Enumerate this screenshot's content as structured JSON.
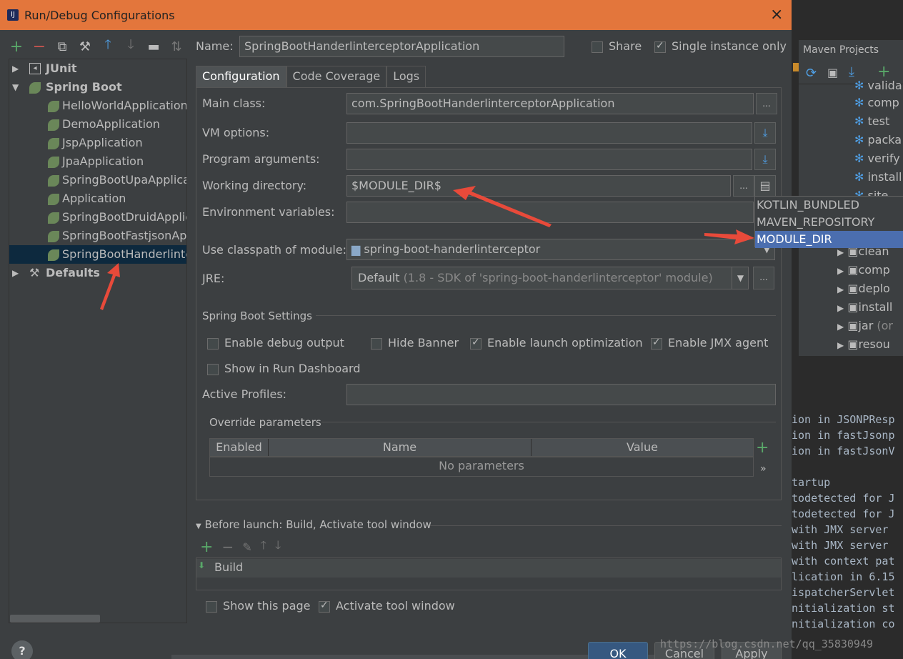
{
  "window": {
    "title": "Run/Debug Configurations",
    "close": "×"
  },
  "tree": {
    "junit": "JUnit",
    "spring_boot": "Spring Boot",
    "items": [
      "HelloWorldApplication",
      "DemoApplication",
      "JspApplication",
      "JpaApplication",
      "SpringBootUpaApplicati",
      "Application",
      "SpringBootDruidApplic",
      "SpringBootFastjsonApp",
      "SpringBootHanderlinte"
    ],
    "defaults": "Defaults"
  },
  "name": {
    "label": "Name:",
    "value": "SpringBootHanderlinterceptorApplication"
  },
  "share": "Share",
  "single_instance": "Single instance only",
  "tabs": [
    "Configuration",
    "Code Coverage",
    "Logs"
  ],
  "form": {
    "main_class_label": "Main class:",
    "main_class_value": "com.SpringBootHanderlinterceptorApplication",
    "vm_label": "VM options:",
    "program_args_label": "Program arguments:",
    "working_dir_label": "Working directory:",
    "working_dir_value": "$MODULE_DIR$",
    "env_label": "Environment variables:",
    "classpath_label": "Use classpath of module:",
    "classpath_value": "spring-boot-handerlinterceptor",
    "jre_label": "JRE:",
    "jre_value": "Default",
    "jre_hint": "(1.8 - SDK of 'spring-boot-handerlinterceptor' module)",
    "more": "..."
  },
  "spring_settings": {
    "title": "Spring Boot Settings",
    "debug_output": "Enable debug output",
    "hide_banner": "Hide Banner",
    "launch_opt": "Enable launch optimization",
    "jmx": "Enable JMX agent",
    "run_dashboard": "Show in Run Dashboard",
    "active_profiles": "Active Profiles:"
  },
  "override": {
    "title": "Override parameters",
    "columns": [
      "Enabled",
      "Name",
      "Value"
    ],
    "empty": "No parameters",
    "plus": "+",
    "more": "»"
  },
  "popup": [
    "KOTLIN_BUNDLED",
    "MAVEN_REPOSITORY",
    "MODULE_DIR"
  ],
  "before_launch": {
    "title": "Before launch: Build, Activate tool window",
    "task": "Build"
  },
  "bottom": {
    "show_page": "Show this page",
    "activate_tool": "Activate tool window"
  },
  "buttons": {
    "ok": "OK",
    "cancel": "Cancel",
    "apply": "Apply",
    "help": "?"
  },
  "maven": {
    "title": "Maven Projects",
    "items": [
      "valida",
      "comp",
      "test",
      "packa",
      "verify",
      "install",
      "site",
      "deplo",
      "s",
      "clean",
      "comp",
      "deplo",
      "install",
      "jar",
      "resou"
    ],
    "jar_suffix": "(or"
  },
  "console": [
    "",
    "ion in JSONPResp",
    "ion in fastJsonp",
    "ion in fastJsonV",
    "",
    "tartup",
    "todetected for J",
    "todetected for J",
    " with JMX server",
    " with JMX server",
    "with context pat",
    "lication in 6.15",
    "ispatcherServlet",
    "nitialization st",
    "nitialization co"
  ],
  "watermark": "https://blog.csdn.net/qq_35830949"
}
